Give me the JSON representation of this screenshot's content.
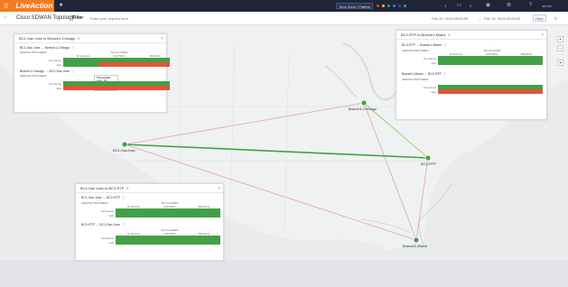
{
  "topbar": {
    "logo_text": "LiveAction",
    "menu_icon": "hamburger-icon",
    "timezone_button": "Time Zone / Pattern",
    "status_dots": [
      "#e53935",
      "#fbc02d",
      "#43a047",
      "#1e88e5",
      "#8e24aa",
      "#26a69a"
    ],
    "counter_a": "4",
    "counter_b": "9",
    "user_name": "admin"
  },
  "subbar": {
    "back_icon": "back-arrow-icon",
    "title": "Cisco SDWAN Topology",
    "filter_label": "Filter",
    "search_placeholder": "Enter your request here",
    "time_range_start": "Feb 12, 2019 09:00:00",
    "time_range_sep": "→",
    "time_range_end": "Feb 13, 2019 09:00:00",
    "period": "Hour"
  },
  "map": {
    "nodes": [
      {
        "name": "BC1-SanJose",
        "color": "#43a047"
      },
      {
        "name": "Branch1-Chicago",
        "color": "#43a047"
      },
      {
        "name": "BC2-RTP",
        "color": "#43a047"
      },
      {
        "name": "Branch1-Miami",
        "color": "#43a047"
      }
    ],
    "zoom_in": "+",
    "zoom_out": "−",
    "locate": "⌖"
  },
  "panels": {
    "chicago": {
      "title": "BC1-San Jose to Branch1-Chicago",
      "dir1_title": "BC1-San Jose → Branch1-Chicago",
      "dir2_title": "Branch1-Chicago → BC1-San Jose",
      "col_group": "SLA CLASSES",
      "cols": [
        "All Services",
        "CONTROL",
        "BRANCH"
      ],
      "row_group": "SERVICE PROVIDERS",
      "rows": [
        "biz-internet",
        "mpls"
      ],
      "tooltip": {
        "title": "Thresholds",
        "line1": "Loss: 1%",
        "line2": "Latency: 150 ms",
        "line3": "Jitter: 30 ms"
      }
    },
    "miami": {
      "title": "BC2-RTP to Branch1-Miami",
      "dir1_title": "BC2-RTP → Branch1-Miami",
      "dir2_title": "Branch1-Miami → BC2-RTP",
      "col_group": "SLA CLASSES",
      "cols": [
        "All Services",
        "CONTROL",
        "BRANCH"
      ],
      "row_group": "SERVICE PROVIDERS",
      "rows": [
        "biz-internet",
        "mpls"
      ]
    },
    "rtp": {
      "title": "BC1-San Jose to BC2-RTP",
      "dir1_title": "BC1-San Jose → BC2-RTP",
      "dir2_title": "BC2-RTP → BC1-San Jose",
      "col_group": "SLA CLASSES",
      "cols": [
        "All Services",
        "CONTROL",
        "BRANCH"
      ],
      "row_group": "SERVICE PROVIDERS",
      "rows": [
        "biz-internet",
        "mpls"
      ]
    }
  }
}
